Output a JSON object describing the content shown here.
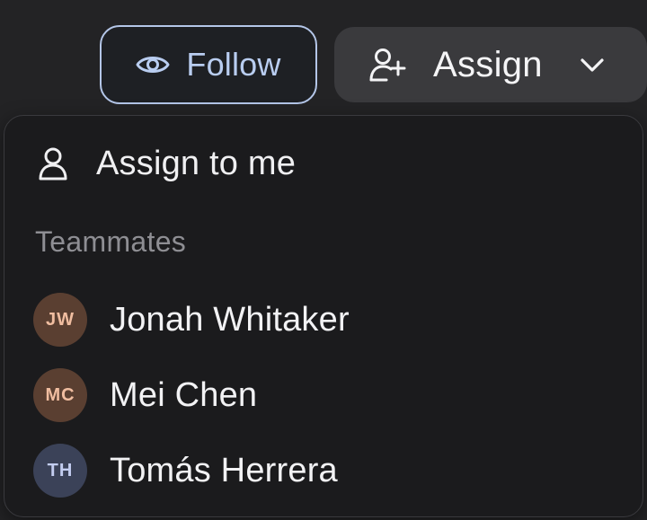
{
  "toolbar": {
    "follow_label": "Follow",
    "assign_label": "Assign"
  },
  "menu": {
    "assign_to_me": "Assign to me",
    "section_label": "Teammates",
    "members": [
      {
        "initials": "JW",
        "name": "Jonah Whitaker",
        "avatar_bg": "#5a3f31",
        "avatar_fg": "#f0bda0"
      },
      {
        "initials": "MC",
        "name": "Mei Chen",
        "avatar_bg": "#5a3f31",
        "avatar_fg": "#f0bda0"
      },
      {
        "initials": "TH",
        "name": "Tomás Herrera",
        "avatar_bg": "#3b4258",
        "avatar_fg": "#c3cdf0"
      }
    ]
  },
  "colors": {
    "follow_accent": "#b9cdf0",
    "background": "#232325",
    "menu_bg": "#1b1b1d"
  },
  "icons": {
    "follow": "eye-icon",
    "assign": "user-plus-icon",
    "dropdown": "chevron-down-icon",
    "assign_me": "user-icon"
  }
}
